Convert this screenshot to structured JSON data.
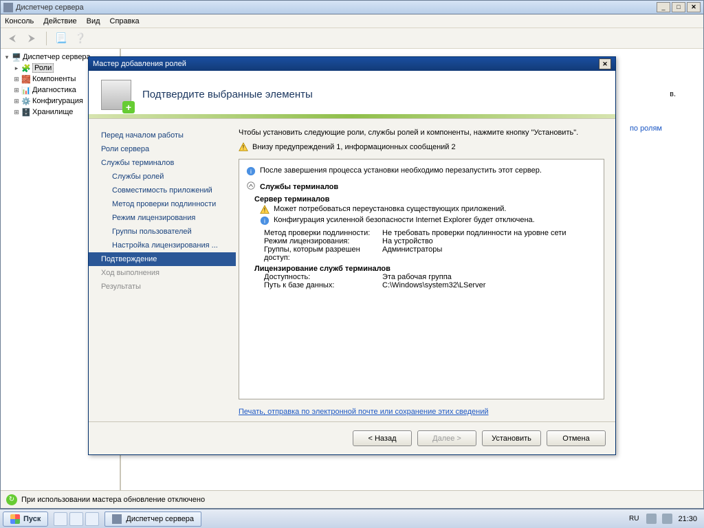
{
  "window": {
    "title": "Диспетчер сервера",
    "min": "_",
    "max": "□",
    "close": "✕"
  },
  "menubar": [
    "Консоль",
    "Действие",
    "Вид",
    "Справка"
  ],
  "tree": {
    "root": "Диспетчер сервера",
    "items": [
      {
        "label": "Роли",
        "icon": "🧩",
        "selected": true
      },
      {
        "label": "Компоненты",
        "icon": "🧱"
      },
      {
        "label": "Диагностика",
        "icon": "📊"
      },
      {
        "label": "Конфигурация",
        "icon": "⚙️"
      },
      {
        "label": "Хранилище",
        "icon": "🗄️"
      }
    ]
  },
  "right": {
    "role_link": "по ролям",
    "ends": "в."
  },
  "status": "При использовании мастера обновление отключено",
  "wizard": {
    "title": "Мастер добавления ролей",
    "heading": "Подтвердите выбранные элементы",
    "nav": [
      {
        "label": "Перед началом работы"
      },
      {
        "label": "Роли сервера"
      },
      {
        "label": "Службы терминалов"
      },
      {
        "label": "Службы ролей",
        "sub": true
      },
      {
        "label": "Совместимость приложений",
        "sub": true
      },
      {
        "label": "Метод проверки подлинности",
        "sub": true
      },
      {
        "label": "Режим лицензирования",
        "sub": true
      },
      {
        "label": "Группы пользователей",
        "sub": true
      },
      {
        "label": "Настройка лицензирования ...",
        "sub": true
      },
      {
        "label": "Подтверждение",
        "sel": true
      },
      {
        "label": "Ход выполнения",
        "dis": true
      },
      {
        "label": "Результаты",
        "dis": true
      }
    ],
    "intro": "Чтобы установить следующие роли, службы ролей и компоненты, нажмите кнопку \"Установить\".",
    "warn_summary": "Внизу предупреждений 1, информационных сообщений 2",
    "info1": "После завершения процесса установки необходимо перезапустить этот сервер.",
    "section1": "Службы терминалов",
    "sub1": "Сервер терминалов",
    "warn1": "Может потребоваться переустановка существующих приложений.",
    "info2": "Конфигурация усиленной безопасности Internet Explorer будет отключена.",
    "kv": [
      {
        "k": "Метод проверки подлинности:",
        "v": "Не требовать проверки подлинности на уровне сети"
      },
      {
        "k": "Режим лицензирования:",
        "v": "На устройство"
      },
      {
        "k": "Группы, которым разрешен доступ:",
        "v": "Администраторы"
      }
    ],
    "sub2": "Лицензирование служб терминалов",
    "kv2": [
      {
        "k": "Доступность:",
        "v": "Эта рабочая группа"
      },
      {
        "k": "Путь к базе данных:",
        "v": "C:\\Windows\\system32\\LServer"
      }
    ],
    "print_link": "Печать, отправка по электронной почте или сохранение этих сведений",
    "buttons": {
      "back": "< Назад",
      "next": "Далее >",
      "install": "Установить",
      "cancel": "Отмена"
    }
  },
  "taskbar": {
    "start": "Пуск",
    "app": "Диспетчер сервера",
    "lang": "RU",
    "clock": "21:30"
  }
}
